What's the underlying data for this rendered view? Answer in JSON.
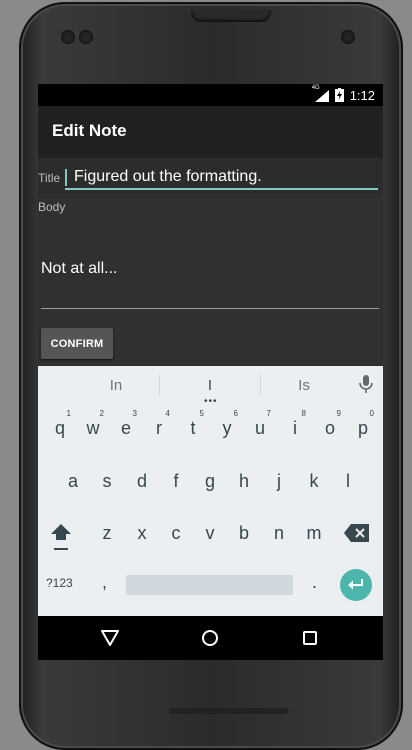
{
  "status_bar": {
    "network_type": "4G",
    "time": "1:12",
    "icons": [
      "signal-icon",
      "battery-icon"
    ]
  },
  "app_bar": {
    "title": "Edit Note"
  },
  "form": {
    "title_label": "Title",
    "title_value": "Figured out the formatting.",
    "body_label": "Body",
    "body_value": "Not at all...",
    "confirm_label": "CONFIRM"
  },
  "keyboard": {
    "suggestions": [
      "In",
      "I",
      "Is"
    ],
    "row1": [
      {
        "char": "q",
        "hint": "1"
      },
      {
        "char": "w",
        "hint": "2"
      },
      {
        "char": "e",
        "hint": "3"
      },
      {
        "char": "r",
        "hint": "4"
      },
      {
        "char": "t",
        "hint": "5"
      },
      {
        "char": "y",
        "hint": "6"
      },
      {
        "char": "u",
        "hint": "7"
      },
      {
        "char": "i",
        "hint": "8"
      },
      {
        "char": "o",
        "hint": "9"
      },
      {
        "char": "p",
        "hint": "0"
      }
    ],
    "row2": [
      "a",
      "s",
      "d",
      "f",
      "g",
      "h",
      "j",
      "k",
      "l"
    ],
    "row3": [
      "z",
      "x",
      "c",
      "v",
      "b",
      "n",
      "m"
    ],
    "symbols_label": "?123",
    "comma": ",",
    "period": ".",
    "icons": [
      "mic-icon",
      "shift-icon",
      "backspace-icon",
      "enter-icon"
    ]
  },
  "nav_bar": {
    "icons": [
      "back-icon",
      "home-icon",
      "recents-icon"
    ]
  },
  "colors": {
    "accent": "#80cbc4",
    "enter_key": "#4db6ac",
    "keyboard_bg": "#eceff1",
    "app_bar": "#212121",
    "screen_bg": "#303030"
  }
}
